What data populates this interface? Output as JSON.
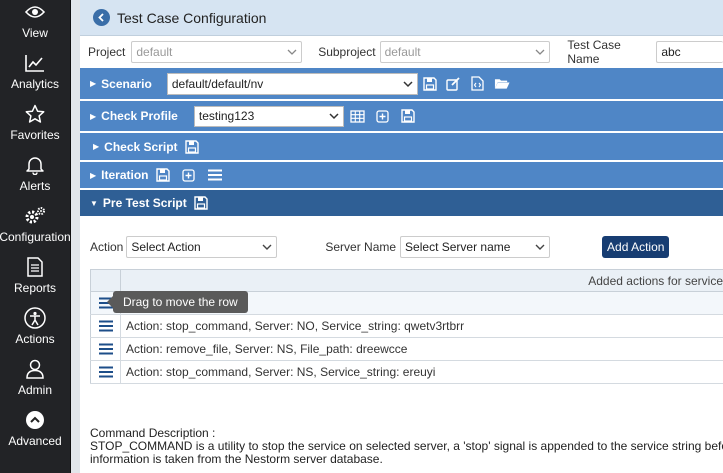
{
  "sidebar": {
    "items": [
      {
        "label": "View",
        "icon": "eye-icon"
      },
      {
        "label": "Analytics",
        "icon": "chart-icon"
      },
      {
        "label": "Favorites",
        "icon": "star-icon"
      },
      {
        "label": "Alerts",
        "icon": "bell-icon"
      },
      {
        "label": "Configuration",
        "icon": "gears-icon"
      },
      {
        "label": "Reports",
        "icon": "document-icon"
      },
      {
        "label": "Actions",
        "icon": "person-circle-icon"
      },
      {
        "label": "Admin",
        "icon": "user-icon"
      },
      {
        "label": "Advanced",
        "icon": "chevron-up-circle-icon"
      }
    ]
  },
  "header": {
    "title": "Test Case Configuration"
  },
  "selectors": {
    "project_label": "Project",
    "project_value": "default",
    "subproject_label": "Subproject",
    "subproject_value": "default",
    "testcase_label": "Test Case Name",
    "testcase_value": "abc"
  },
  "sections": {
    "scenario": {
      "title": "Scenario",
      "value": "default/default/nv"
    },
    "check_profile": {
      "title": "Check Profile",
      "value": "testing123"
    },
    "check_script": {
      "title": "Check Script"
    },
    "iteration": {
      "title": "Iteration"
    },
    "pre_test_script": {
      "title": "Pre Test Script"
    }
  },
  "pre_test": {
    "action_label": "Action",
    "action_value": "Select Action",
    "server_label": "Server Name",
    "server_value": "Select Server name",
    "add_button": "Add Action"
  },
  "table": {
    "header": "Added actions for service",
    "tooltip": "Drag to move the row",
    "rows": [
      {
        "text": ""
      },
      {
        "text": "Action: stop_command, Server: NO, Service_string: qwetv3rtbrr"
      },
      {
        "text": "Action: remove_file, Server: NS, File_path: dreewcce"
      },
      {
        "text": "Action: stop_command, Server: NS, Service_string: ereuyi"
      }
    ]
  },
  "description": {
    "title": "Command Description :",
    "line1": "STOP_COMMAND is a utility to stop the service on selected server, a 'stop' signal is appended to the service string before executin",
    "line2": "information is taken from the Nestorm server database."
  },
  "colors": {
    "sidebar": "#222326",
    "section_bar": "#4f86c6",
    "section_bar_active": "#2f5f95",
    "add_button": "#173d72"
  }
}
